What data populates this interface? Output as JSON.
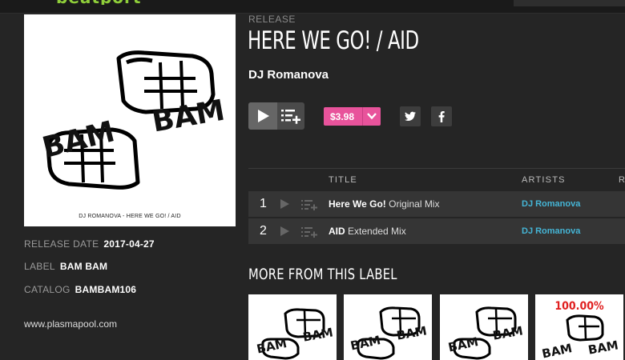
{
  "brand": {
    "logo_text": "beatport"
  },
  "release": {
    "type_label": "RELEASE",
    "title": "HERE WE GO! / AID",
    "artist": "DJ Romanova",
    "price": "$3.98",
    "cover_caption": "DJ ROMANOVA - HERE WE GO! / AID",
    "cover_word_left": "BAM",
    "cover_word_right": "BAM"
  },
  "meta": {
    "release_date_label": "RELEASE DATE",
    "release_date": "2017-04-27",
    "label_label": "LABEL",
    "label": "BAM BAM",
    "catalog_label": "CATALOG",
    "catalog": "BAMBAM106",
    "website": "www.plasmapool.com"
  },
  "tracklist": {
    "headers": {
      "title": "TITLE",
      "artists": "ARTISTS",
      "extra": "R"
    },
    "tracks": [
      {
        "num": "1",
        "name": "Here We Go!",
        "mix": " Original Mix",
        "artist": "DJ Romanova"
      },
      {
        "num": "2",
        "name": "AID",
        "mix": " Extended Mix",
        "artist": "DJ Romanova"
      }
    ]
  },
  "more_label": {
    "heading": "MORE FROM THIS LABEL",
    "items": [
      {
        "word_left": "BAM",
        "word_right": "BAM",
        "badge": ""
      },
      {
        "word_left": "BAM",
        "word_right": "BAM",
        "badge": ""
      },
      {
        "word_left": "BAM",
        "word_right": "BAM",
        "badge": ""
      },
      {
        "word_left": "BAM",
        "word_right": "BAM",
        "badge": "100.00%"
      }
    ]
  },
  "colors": {
    "background": "#252525",
    "price_pink": "#e8539b",
    "artist_link": "#45b5d6",
    "brand_green": "#8fce3a"
  },
  "icons": [
    "play-icon",
    "add-to-queue-icon",
    "chevron-down-icon",
    "twitter-icon",
    "facebook-icon"
  ]
}
